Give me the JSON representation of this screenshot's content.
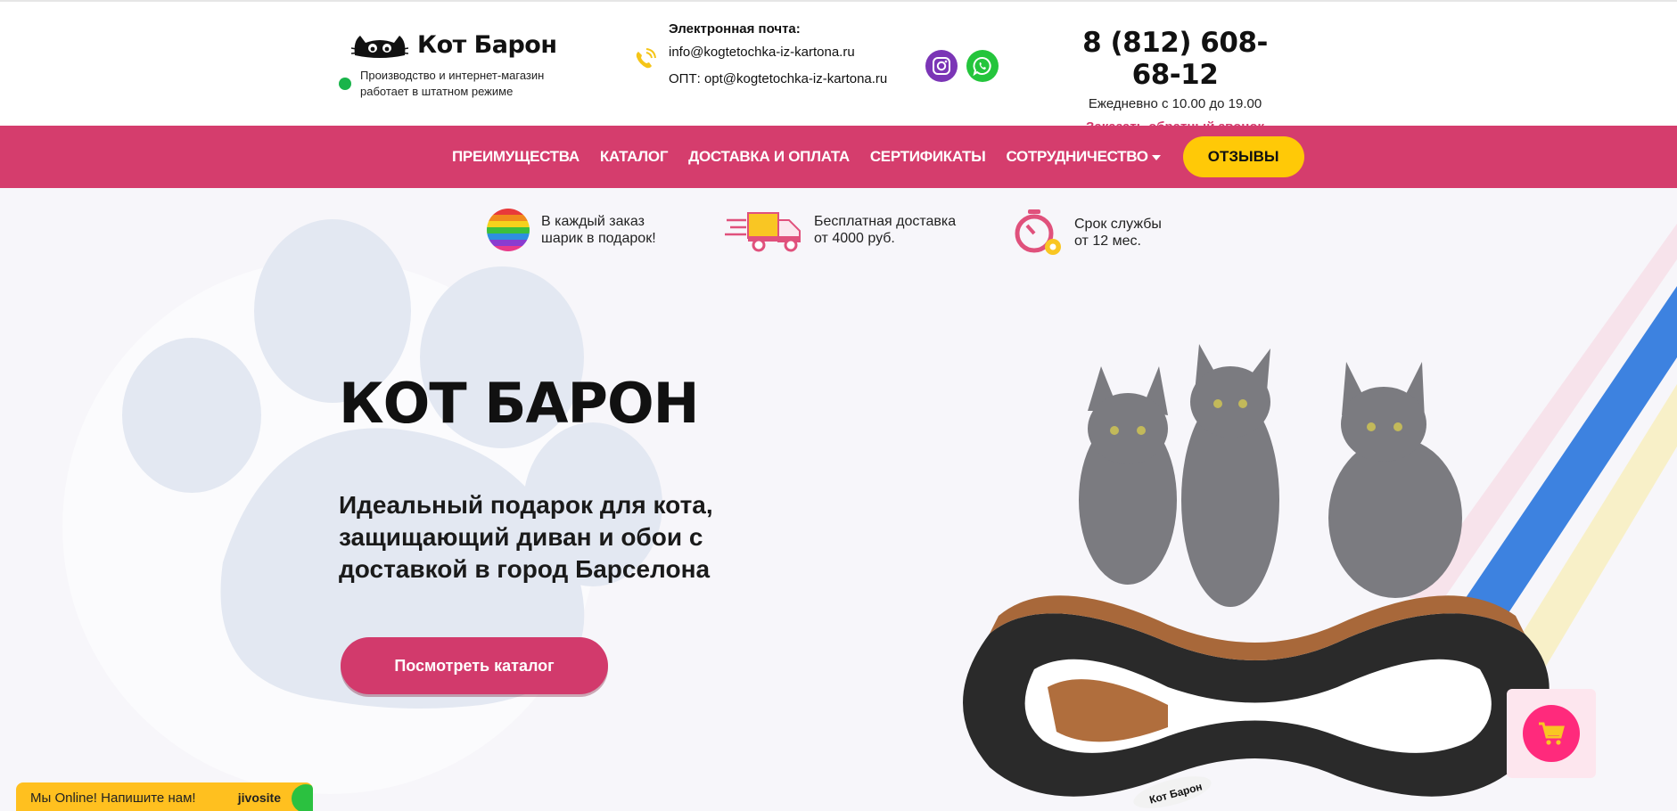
{
  "header": {
    "logo_text": "Кот Барон",
    "status_text": "Производство и интернет-магазин работает в штатном режиме",
    "email_label": "Электронная почта:",
    "email_main": "info@kogtetochka-iz-kartona.ru",
    "email_opt": "ОПТ: opt@kogtetochka-iz-kartona.ru",
    "phone": "8 (812) 608-68-12",
    "hours": "Ежедневно с 10.00 до 19.00",
    "callback": "Заказать обратный звонок"
  },
  "nav": {
    "items": [
      "ПРЕИМУЩЕСТВА",
      "КАТАЛОГ",
      "ДОСТАВКА И ОПЛАТА",
      "СЕРТИФИКАТЫ",
      "СОТРУДНИЧЕСТВО"
    ],
    "reviews": "ОТЗЫВЫ"
  },
  "features": [
    {
      "icon": "rainbow-ball-icon",
      "line1": "В каждый заказ",
      "line2": "шарик в подарок!"
    },
    {
      "icon": "delivery-truck-icon",
      "line1": "Бесплатная доставка",
      "line2": "от 4000 руб."
    },
    {
      "icon": "stopwatch-icon",
      "line1": "Срок службы",
      "line2": "от 12 мес."
    }
  ],
  "hero": {
    "title": "КОТ БАРОН",
    "subtitle": "Идеальный подарок для кота, защищающий диван и обои с доставкой в город Барселона",
    "button": "Посмотреть каталог",
    "product_label": "Кот Барон"
  },
  "chat": {
    "text": "Мы Online! Напишите нам!",
    "brand": "jivosite"
  },
  "colors": {
    "accent": "#d53d6d",
    "yellow": "#ffc907",
    "cart": "#ff2a7c"
  }
}
